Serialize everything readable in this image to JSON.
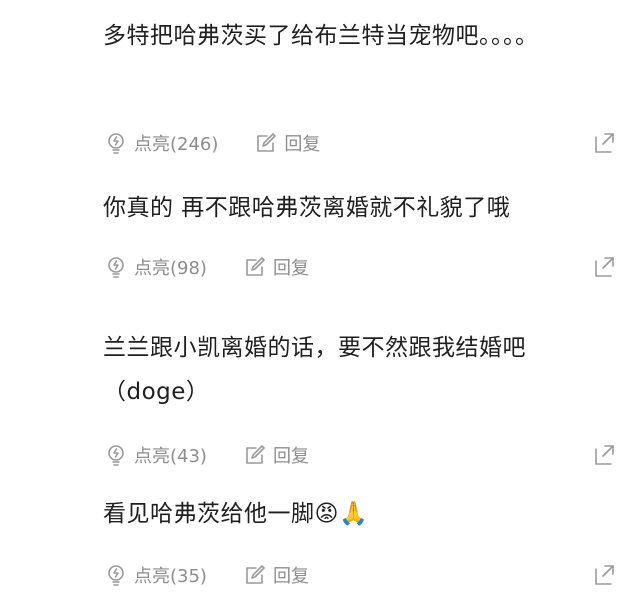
{
  "comments": [
    {
      "text": "多特把哈弗茨买了给布兰特当宠物吧。。。。",
      "like_label": "点亮(246)",
      "reply_label": "回复"
    },
    {
      "text": "你真的 再不跟哈弗茨离婚就不礼貌了哦",
      "like_label": "点亮(98)",
      "reply_label": "回复"
    },
    {
      "text": "兰兰跟小凯离婚的话，要不然跟我结婚吧（doge）",
      "like_label": "点亮(43)",
      "reply_label": "回复"
    },
    {
      "text": "看见哈弗茨给他一脚😡🙏",
      "like_label": "点亮(35)",
      "reply_label": "回复"
    }
  ],
  "icons": {
    "like": "lightbulb-icon",
    "reply": "edit-icon",
    "share": "share-icon"
  },
  "colors": {
    "text": "#1f1f1f",
    "meta": "#8d8d8d"
  }
}
